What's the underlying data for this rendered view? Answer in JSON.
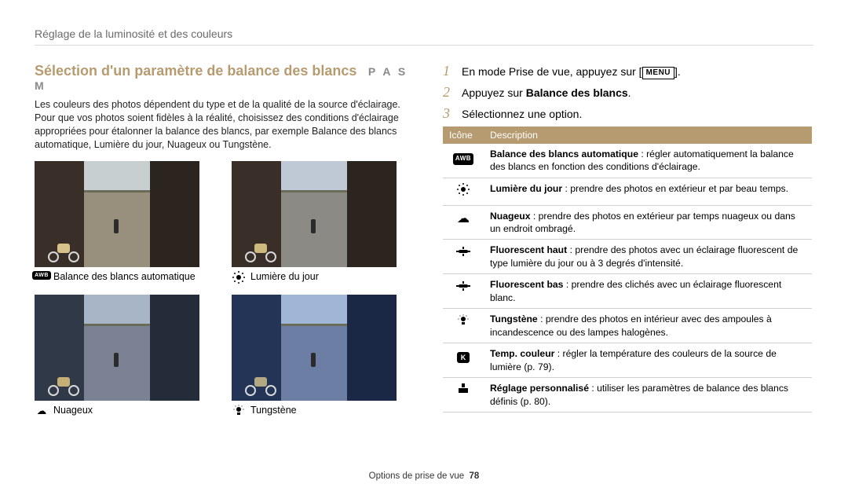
{
  "breadcrumb": "Réglage de la luminosité et des couleurs",
  "section_title": "Sélection d'un paramètre de balance des blancs",
  "modes": "P A S M",
  "intro": "Les couleurs des photos dépendent du type et de la qualité de la source d'éclairage. Pour que vos photos soient fidèles à la réalité, choisissez des conditions d'éclairage appropriées pour étalonner la balance des blancs, par exemple Balance des blancs automatique, Lumière du jour, Nuageux ou Tungstène.",
  "samples": {
    "awb_icon": "AWB",
    "awb": "Balance des blancs automatique",
    "daylight": "Lumière du jour",
    "cloudy": "Nuageux",
    "tungsten": "Tungstène"
  },
  "steps": {
    "s1_pre": "En mode Prise de vue, appuyez sur [",
    "s1_btn": "MENU",
    "s1_post": "].",
    "s2_pre": "Appuyez sur ",
    "s2_bold": "Balance des blancs",
    "s2_post": ".",
    "s3": "Sélectionnez une option."
  },
  "table": {
    "h_icon": "Icône",
    "h_desc": "Description",
    "rows": [
      {
        "bold": "Balance des blancs automatique",
        "rest": " : régler automatiquement la balance des blancs en fonction des conditions d'éclairage."
      },
      {
        "bold": "Lumière du jour",
        "rest": " : prendre des photos en extérieur et par beau temps."
      },
      {
        "bold": "Nuageux",
        "rest": " : prendre des photos en extérieur par temps nuageux ou dans un endroit ombragé."
      },
      {
        "bold": "Fluorescent haut",
        "rest": " : prendre des photos avec un éclairage fluorescent de type lumière du jour ou à 3 degrés d'intensité."
      },
      {
        "bold": "Fluorescent bas",
        "rest": " : prendre des clichés avec un éclairage fluorescent blanc."
      },
      {
        "bold": "Tungstène",
        "rest": " : prendre des photos en intérieur avec des ampoules à incandescence ou des lampes halogènes."
      },
      {
        "bold": "Temp. couleur",
        "rest": " : régler la température des couleurs de la source de lumière (p. 79)."
      },
      {
        "bold": "Réglage personnalisé",
        "rest": " : utiliser les paramètres de balance des blancs définis (p. 80)."
      }
    ],
    "awb_label": "AWB",
    "k_label": "K"
  },
  "footer": {
    "section": "Options de prise de vue",
    "page": "78"
  }
}
